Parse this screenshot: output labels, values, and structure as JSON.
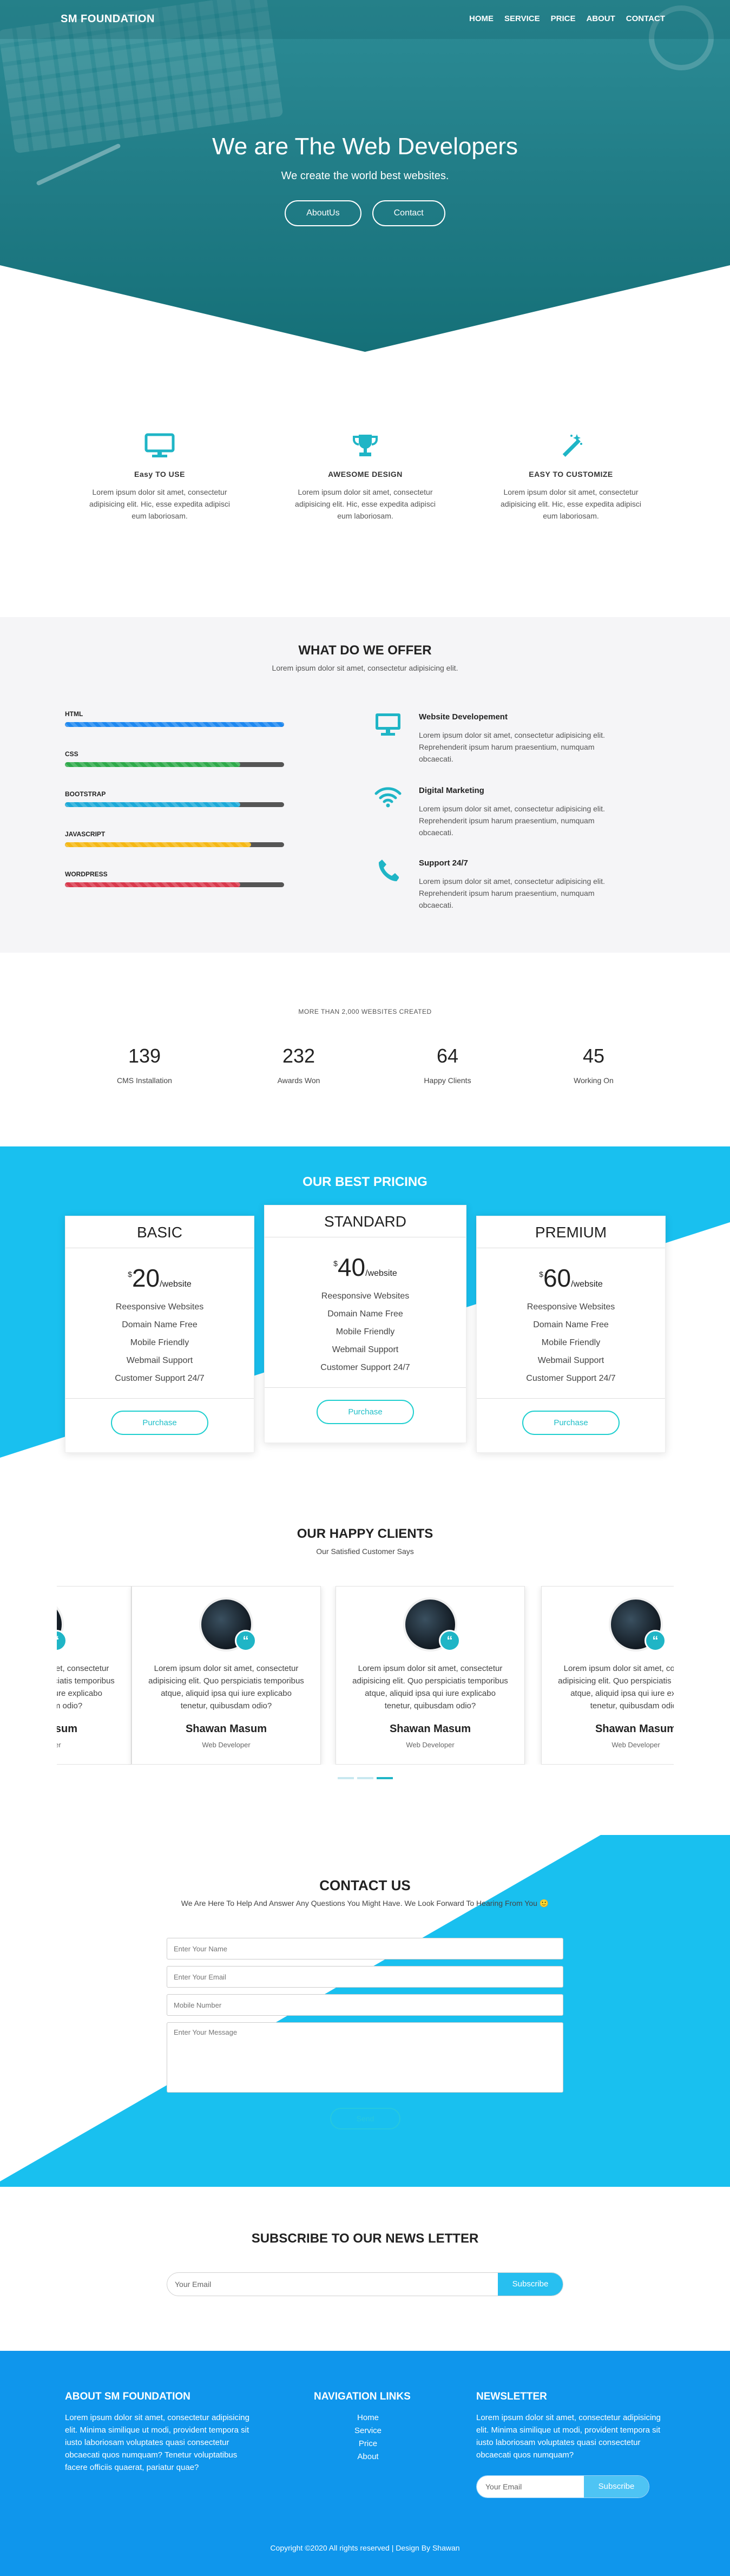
{
  "nav": {
    "brand": "SM FOUNDATION",
    "links": [
      "HOME",
      "SERVICE",
      "PRICE",
      "ABOUT",
      "CONTACT"
    ]
  },
  "hero": {
    "title": "We are The Web Developers",
    "subtitle": "We create the world best websites.",
    "btn_about": "AboutUs",
    "btn_contact": "Contact"
  },
  "features": [
    {
      "icon": "monitor-icon",
      "title": "Easy TO USE",
      "text": "Lorem ipsum dolor sit amet, consectetur adipisicing elit. Hic, esse expedita adipisci eum laboriosam."
    },
    {
      "icon": "trophy-icon",
      "title": "AWESOME DESIGN",
      "text": "Lorem ipsum dolor sit amet, consectetur adipisicing elit. Hic, esse expedita adipisci eum laboriosam."
    },
    {
      "icon": "magic-wand-icon",
      "title": "EASY TO CUSTOMIZE",
      "text": "Lorem ipsum dolor sit amet, consectetur adipisicing elit. Hic, esse expedita adipisci eum laboriosam."
    }
  ],
  "offer": {
    "title": "WHAT DO WE OFFER",
    "lead": "Lorem ipsum dolor sit amet, consectetur adipisicing elit.",
    "skills": [
      {
        "name": "HTML",
        "level": 100,
        "color": "#1e88f0"
      },
      {
        "name": "CSS",
        "level": 80,
        "color": "#2eaa4a"
      },
      {
        "name": "BOOTSTRAP",
        "level": 80,
        "color": "#1ba9d8"
      },
      {
        "name": "JAVASCRIPT",
        "level": 85,
        "color": "#f5b815"
      },
      {
        "name": "WORDPRESS",
        "level": 80,
        "color": "#d9394d"
      }
    ],
    "services": [
      {
        "icon": "desktop-icon",
        "title": "Website Developement",
        "text": "Lorem ipsum dolor sit amet, consectetur adipisicing elit. Reprehenderit ipsum harum praesentium, numquam obcaecati."
      },
      {
        "icon": "wifi-icon",
        "title": "Digital Marketing",
        "text": "Lorem ipsum dolor sit amet, consectetur adipisicing elit. Reprehenderit ipsum harum praesentium, numquam obcaecati."
      },
      {
        "icon": "phone-icon",
        "title": "Support 24/7",
        "text": "Lorem ipsum dolor sit amet, consectetur adipisicing elit. Reprehenderit ipsum harum praesentium, numquam obcaecati."
      }
    ]
  },
  "stats": {
    "caption": "MORE THAN 2,000 WEBSITES CREATED",
    "items": [
      {
        "num": "139",
        "label": "CMS Installation"
      },
      {
        "num": "232",
        "label": "Awards Won"
      },
      {
        "num": "64",
        "label": "Happy Clients"
      },
      {
        "num": "45",
        "label": "Working On"
      }
    ]
  },
  "pricing": {
    "title": "OUR BEST PRICING",
    "plans": [
      {
        "name": "BASIC",
        "currency": "$",
        "amount": "20",
        "per": "/website",
        "features": [
          "Reesponsive Websites",
          "Domain Name Free",
          "Mobile Friendly",
          "Webmail Support",
          "Customer Support 24/7"
        ],
        "btn": "Purchase"
      },
      {
        "name": "STANDARD",
        "currency": "$",
        "amount": "40",
        "per": "/website",
        "features": [
          "Reesponsive Websites",
          "Domain Name Free",
          "Mobile Friendly",
          "Webmail Support",
          "Customer Support 24/7"
        ],
        "btn": "Purchase"
      },
      {
        "name": "PREMIUM",
        "currency": "$",
        "amount": "60",
        "per": "/website",
        "features": [
          "Reesponsive Websites",
          "Domain Name Free",
          "Mobile Friendly",
          "Webmail Support",
          "Customer Support 24/7"
        ],
        "btn": "Purchase"
      }
    ]
  },
  "clients": {
    "title": "OUR HAPPY CLIENTS",
    "caption": "Our Satisfied Customer Says",
    "quote_mark": "“",
    "testimonials": [
      {
        "text": "Lorem ipsum dolor sit amet, consectetur adipisicing elit. Quo perspiciatis temporibus atque, aliquid ipsa qui iure explicabo tenetur, quibusdam odio?",
        "name": "Shawan Masum",
        "role": "Web Developer"
      },
      {
        "text": "Lorem ipsum dolor sit amet, consectetur adipisicing elit. Quo perspiciatis temporibus atque, aliquid ipsa qui iure explicabo tenetur, quibusdam odio?",
        "name": "Shawan Masum",
        "role": "Web Developer"
      },
      {
        "text": "Lorem ipsum dolor sit amet, consectetur adipisicing elit. Quo perspiciatis temporibus atque, aliquid ipsa qui iure explicabo tenetur, quibusdam odio?",
        "name": "Shawan Masum",
        "role": "Web Developer"
      },
      {
        "text": "Lorem ipsum dolor sit amet, consectetur adipisicing elit. Quo perspiciatis temporibus atque, aliquid ipsa qui iure explicabo tenetur, quibusdam odio?",
        "name": "Shawan Masum",
        "role": "Web Developer"
      }
    ]
  },
  "contact": {
    "title": "CONTACT US",
    "caption": "We Are Here To Help And Answer Any Questions You Might Have. We Look Forward To Hearing From You 🙂",
    "name_placeholder": "Enter Your Name",
    "email_placeholder": "Enter Your Email",
    "mobile_placeholder": "Mobile Number",
    "message_placeholder": "Enter Your Message",
    "submit": "Send"
  },
  "subscribe": {
    "title": "SUBSCRIBE TO OUR NEWS LETTER",
    "placeholder": "Your Email",
    "button": "Subscribe"
  },
  "footer": {
    "about_title": "ABOUT SM FOUNDATION",
    "about_text": "Lorem ipsum dolor sit amet, consectetur adipisicing elit. Minima similique ut modi, provident tempora sit iusto laboriosam voluptates quasi consectetur obcaecati quos numquam? Tenetur voluptatibus facere officiis quaerat, pariatur quae?",
    "nav_title": "NAVIGATION LINKS",
    "nav_links": [
      "Home",
      "Service",
      "Price",
      "About"
    ],
    "news_title": "NEWSLETTER",
    "news_text": "Lorem ipsum dolor sit amet, consectetur adipisicing elit. Minima similique ut modi, provident tempora sit iusto laboriosam voluptates quasi consectetur obcaecati quos numquam?",
    "news_placeholder": "Your Email",
    "news_button": "Subscribe",
    "copyright": "Copyright ©2020 All rights reserved | Design By Shawan"
  }
}
